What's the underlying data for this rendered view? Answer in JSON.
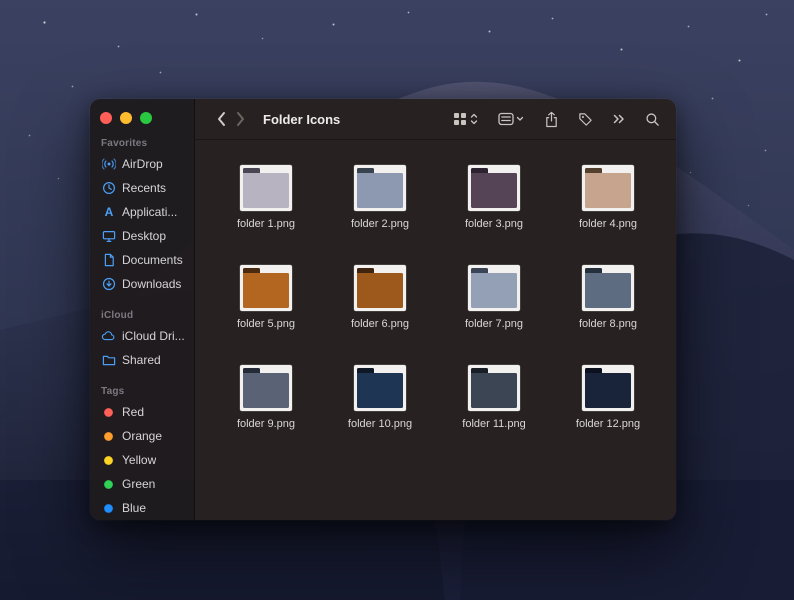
{
  "window": {
    "title": "Folder Icons",
    "traffic_lights": {
      "close": "#ff5f57",
      "minimize": "#febc2e",
      "zoom": "#28c840"
    }
  },
  "toolbar": {
    "icons": [
      "view-picker-icon",
      "group-icon",
      "share-icon",
      "tag-icon",
      "more-icon",
      "search-icon"
    ]
  },
  "sidebar": {
    "sections": [
      {
        "title": "Favorites",
        "items": [
          {
            "label": "AirDrop",
            "icon": "airdrop-icon"
          },
          {
            "label": "Recents",
            "icon": "recents-icon"
          },
          {
            "label": "Applicati...",
            "icon": "applications-icon"
          },
          {
            "label": "Desktop",
            "icon": "desktop-icon"
          },
          {
            "label": "Documents",
            "icon": "documents-icon"
          },
          {
            "label": "Downloads",
            "icon": "downloads-icon"
          }
        ]
      },
      {
        "title": "iCloud",
        "items": [
          {
            "label": "iCloud Dri...",
            "icon": "icloud-drive-icon"
          },
          {
            "label": "Shared",
            "icon": "shared-folder-icon"
          }
        ]
      },
      {
        "title": "Tags",
        "items": [
          {
            "label": "Red",
            "icon": "tag-dot",
            "color": "#ff6159"
          },
          {
            "label": "Orange",
            "icon": "tag-dot",
            "color": "#ff9d2e"
          },
          {
            "label": "Yellow",
            "icon": "tag-dot",
            "color": "#ffd426"
          },
          {
            "label": "Green",
            "icon": "tag-dot",
            "color": "#2fd157"
          },
          {
            "label": "Blue",
            "icon": "tag-dot",
            "color": "#1f8fff"
          }
        ]
      }
    ]
  },
  "files": [
    {
      "name": "folder 1.png",
      "body_color": "#b7b3c0",
      "tab_color": "#4a4653"
    },
    {
      "name": "folder 2.png",
      "body_color": "#8c99b0",
      "tab_color": "#39424f"
    },
    {
      "name": "folder 3.png",
      "body_color": "#554455",
      "tab_color": "#2d2230"
    },
    {
      "name": "folder 4.png",
      "body_color": "#c6a48d",
      "tab_color": "#53402f"
    },
    {
      "name": "folder 5.png",
      "body_color": "#b2661f",
      "tab_color": "#4a2b10"
    },
    {
      "name": "folder 6.png",
      "body_color": "#9d591c",
      "tab_color": "#3f2410"
    },
    {
      "name": "folder 7.png",
      "body_color": "#93a0b6",
      "tab_color": "#3b4454"
    },
    {
      "name": "folder 8.png",
      "body_color": "#5d6c81",
      "tab_color": "#26303c"
    },
    {
      "name": "folder 9.png",
      "body_color": "#5a6375",
      "tab_color": "#252b36"
    },
    {
      "name": "folder 10.png",
      "body_color": "#1e3553",
      "tab_color": "#0e1826"
    },
    {
      "name": "folder 11.png",
      "body_color": "#3c4554",
      "tab_color": "#181d26"
    },
    {
      "name": "folder 12.png",
      "body_color": "#19243b",
      "tab_color": "#0b111f"
    }
  ]
}
